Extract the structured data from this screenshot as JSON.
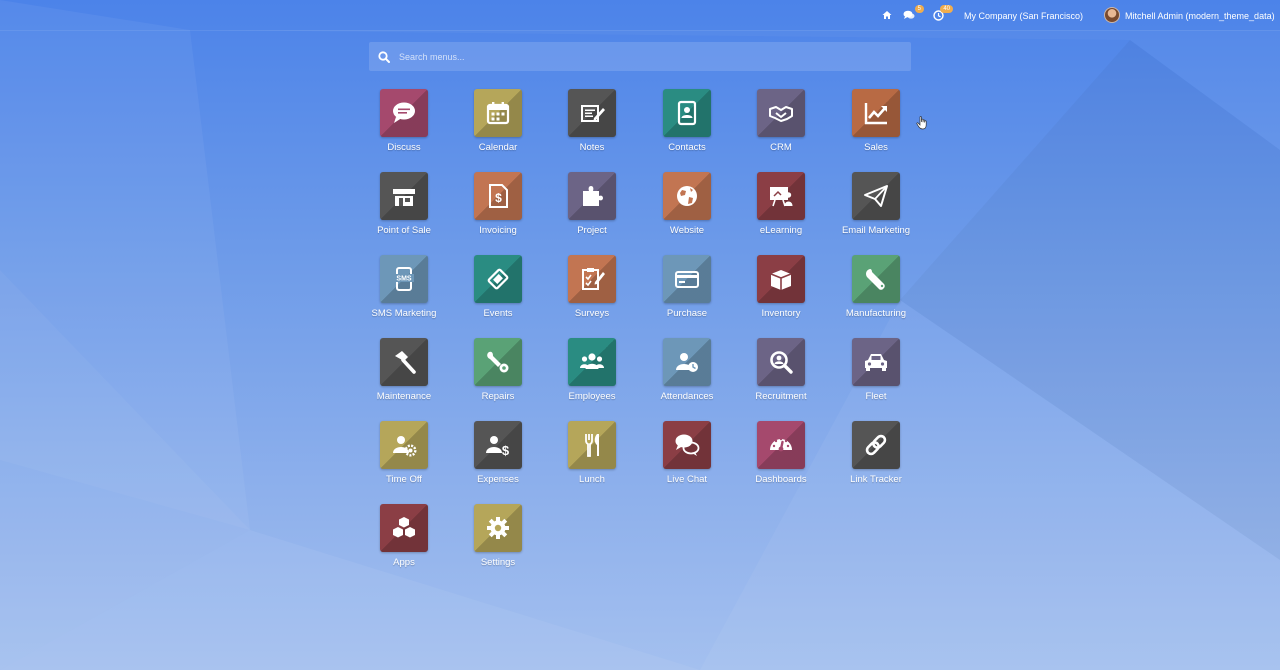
{
  "topbar": {
    "company": "My Company (San Francisco)",
    "user": "Mitchell Admin (modern_theme_data)",
    "messages_count": "5",
    "activities_count": "40"
  },
  "search": {
    "placeholder": "Search menus..."
  },
  "apps": [
    {
      "label": "Discuss",
      "icon": "chat-bubble-icon",
      "color": "#a5496d"
    },
    {
      "label": "Calendar",
      "icon": "calendar-icon",
      "color": "#b5a65a"
    },
    {
      "label": "Notes",
      "icon": "notes-icon",
      "color": "#555555"
    },
    {
      "label": "Contacts",
      "icon": "address-book-icon",
      "color": "#2a8c82"
    },
    {
      "label": "CRM",
      "icon": "handshake-icon",
      "color": "#6c6486"
    },
    {
      "label": "Sales",
      "icon": "trending-chart-icon",
      "color": "#b86a44"
    },
    {
      "label": "Point of Sale",
      "icon": "shop-icon",
      "color": "#555555"
    },
    {
      "label": "Invoicing",
      "icon": "invoice-dollar-icon",
      "color": "#c27552"
    },
    {
      "label": "Project",
      "icon": "puzzle-icon",
      "color": "#6c6486"
    },
    {
      "label": "Website",
      "icon": "globe-icon",
      "color": "#c27552"
    },
    {
      "label": "eLearning",
      "icon": "presentation-icon",
      "color": "#8b3e45"
    },
    {
      "label": "Email Marketing",
      "icon": "paper-plane-icon",
      "color": "#555555"
    },
    {
      "label": "SMS Marketing",
      "icon": "sms-phone-icon",
      "color": "#6d97b8"
    },
    {
      "label": "Events",
      "icon": "ticket-icon",
      "color": "#2a8c82"
    },
    {
      "label": "Surveys",
      "icon": "clipboard-check-icon",
      "color": "#c27552"
    },
    {
      "label": "Purchase",
      "icon": "credit-card-icon",
      "color": "#6d97b8"
    },
    {
      "label": "Inventory",
      "icon": "box-icon",
      "color": "#8b3e45"
    },
    {
      "label": "Manufacturing",
      "icon": "wrench-icon",
      "color": "#5aa276"
    },
    {
      "label": "Maintenance",
      "icon": "hammer-icon",
      "color": "#555555"
    },
    {
      "label": "Repairs",
      "icon": "wrench-gear-icon",
      "color": "#5aa276"
    },
    {
      "label": "Employees",
      "icon": "users-icon",
      "color": "#2a8c82"
    },
    {
      "label": "Attendances",
      "icon": "user-clock-icon",
      "color": "#6d97b8"
    },
    {
      "label": "Recruitment",
      "icon": "magnifier-user-icon",
      "color": "#6c6486"
    },
    {
      "label": "Fleet",
      "icon": "car-icon",
      "color": "#6c6486"
    },
    {
      "label": "Time Off",
      "icon": "user-gear-icon",
      "color": "#b5a65a"
    },
    {
      "label": "Expenses",
      "icon": "user-dollar-icon",
      "color": "#555555"
    },
    {
      "label": "Lunch",
      "icon": "fork-knife-icon",
      "color": "#b5a65a"
    },
    {
      "label": "Live Chat",
      "icon": "chat-bubbles-icon",
      "color": "#8b3e45"
    },
    {
      "label": "Dashboards",
      "icon": "gauge-icon",
      "color": "#a5496d"
    },
    {
      "label": "Link Tracker",
      "icon": "link-icon",
      "color": "#555555"
    },
    {
      "label": "Apps",
      "icon": "cubes-icon",
      "color": "#8b3e45"
    },
    {
      "label": "Settings",
      "icon": "gear-icon",
      "color": "#b5a65a"
    }
  ]
}
